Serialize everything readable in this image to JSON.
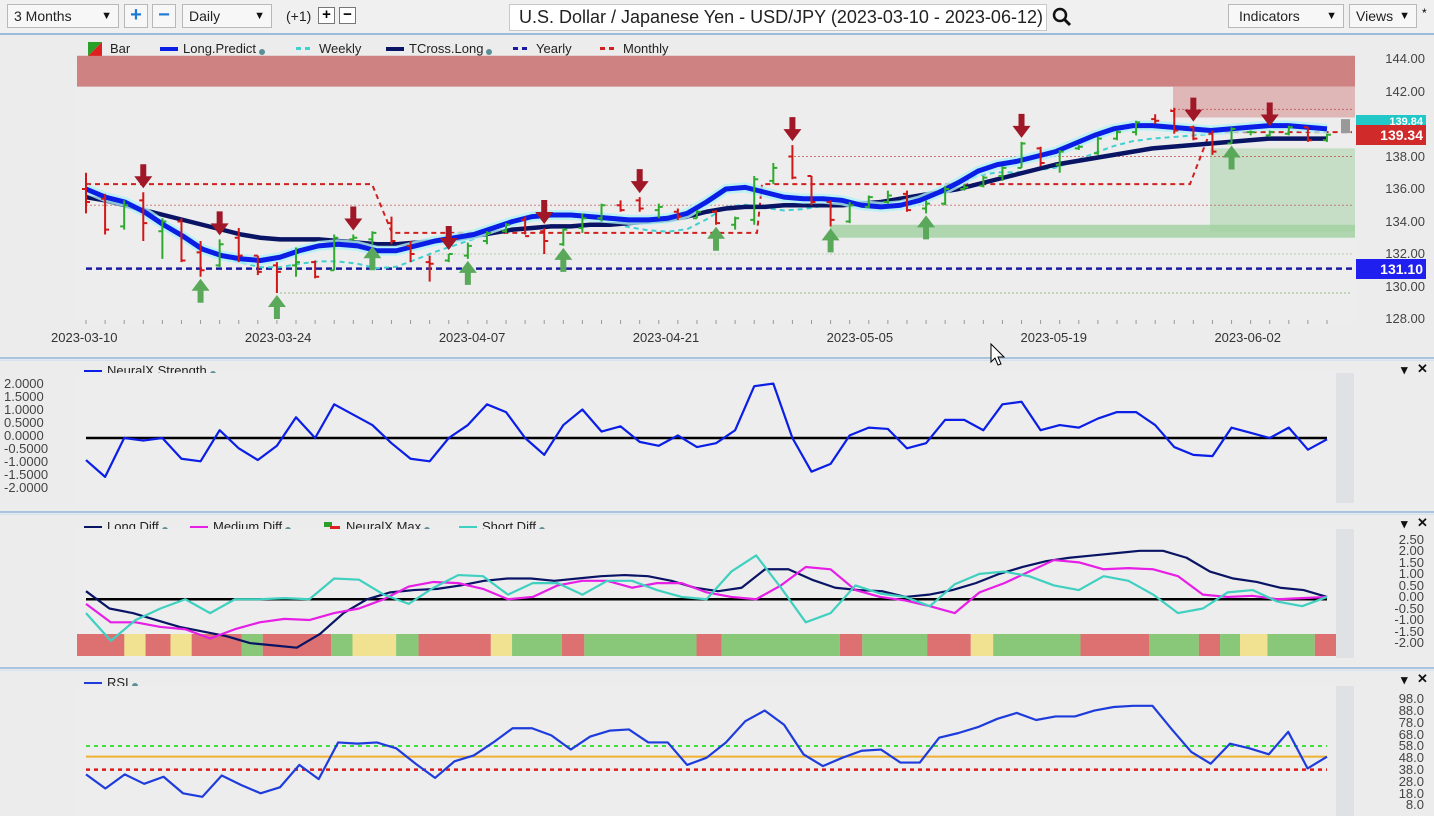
{
  "toolbar": {
    "range_select": "3 Months",
    "zoom_in": "+",
    "zoom_out": "−",
    "interval_select": "Daily",
    "offset_label": "(+1)",
    "offset_plus": "+",
    "offset_minus": "−",
    "title": "U.S. Dollar / Japanese Yen - USD/JPY (2023-03-10 - 2023-06-12)",
    "indicators_select": "Indicators",
    "views_select": "Views",
    "views_marker": "*"
  },
  "price_panel": {
    "legend": [
      {
        "label": "Bar",
        "color": "#2aa02a",
        "style": "bar"
      },
      {
        "label": "Long.Predict",
        "color": "#0a1ee6",
        "style": "solid",
        "dot": true
      },
      {
        "label": "Weekly",
        "color": "#3fd0d0",
        "style": "dash"
      },
      {
        "label": "TCross.Long",
        "color": "#0a1464",
        "style": "solid",
        "dot": true
      },
      {
        "label": "Yearly",
        "color": "#1a1aa0",
        "style": "dash"
      },
      {
        "label": "Monthly",
        "color": "#d02020",
        "style": "dash"
      }
    ],
    "current_price": "139.34",
    "predict_price": "139.84",
    "yearly_level": "131.10",
    "colors": {
      "bull": "#2faa2f",
      "bear": "#d01818",
      "arrow_down": "#a01828",
      "arrow_up": "#5aa85a",
      "resistance_zone": "#c8706e",
      "support_zone": "#9fcf9f",
      "tag_current": "#d02a2a",
      "tag_yearly": "#1f1ff0",
      "tag_predict": "#22c8c8"
    }
  },
  "neural_panel": {
    "legend": [
      {
        "label": "NeuralX.Strength",
        "color": "#0a1ee6",
        "dot": true
      }
    ]
  },
  "diff_panel": {
    "legend": [
      {
        "label": "Long.Diff",
        "color": "#0a1464",
        "dot": true
      },
      {
        "label": "Medium.Diff",
        "color": "#e61ee6",
        "dot": true
      },
      {
        "label": "NeuralX.Max",
        "color": "#d02020",
        "dot": true
      },
      {
        "label": "Short.Diff",
        "color": "#3fd0c0",
        "dot": true
      }
    ]
  },
  "rsi_panel": {
    "legend": [
      {
        "label": "RSI",
        "color": "#1e3cdc",
        "dot": true
      }
    ]
  },
  "panel_controls": {
    "menu": "▾",
    "close": "✕"
  },
  "chart_data": [
    {
      "type": "ohlc",
      "title": "U.S. Dollar / Japanese Yen - USD/JPY (2023-03-10 - 2023-06-12)",
      "ylim": [
        127.5,
        144.5
      ],
      "yticks": [
        "144.00",
        "142.00",
        "140.00",
        "138.00",
        "136.00",
        "134.00",
        "132.00",
        "130.00",
        "128.00"
      ],
      "xticks": [
        "2023-03-10",
        "2023-03-24",
        "2023-04-07",
        "2023-04-21",
        "2023-05-05",
        "2023-05-19",
        "2023-06-02"
      ],
      "bars": [
        {
          "o": 136.0,
          "h": 137.0,
          "l": 134.5,
          "c": 135.2
        },
        {
          "o": 135.4,
          "h": 135.7,
          "l": 133.2,
          "c": 133.5
        },
        {
          "o": 133.7,
          "h": 135.3,
          "l": 133.5,
          "c": 135.0
        },
        {
          "o": 135.3,
          "h": 135.8,
          "l": 132.8,
          "c": 133.9
        },
        {
          "o": 133.4,
          "h": 134.2,
          "l": 131.7,
          "c": 134.0
        },
        {
          "o": 134.0,
          "h": 134.2,
          "l": 131.5,
          "c": 131.6
        },
        {
          "o": 132.1,
          "h": 132.8,
          "l": 130.6,
          "c": 131.0
        },
        {
          "o": 131.3,
          "h": 132.9,
          "l": 131.2,
          "c": 132.6
        },
        {
          "o": 133.0,
          "h": 133.6,
          "l": 131.5,
          "c": 131.9
        },
        {
          "o": 131.9,
          "h": 131.9,
          "l": 130.7,
          "c": 130.9
        },
        {
          "o": 131.3,
          "h": 131.5,
          "l": 129.6,
          "c": 130.9
        },
        {
          "o": 131.3,
          "h": 132.4,
          "l": 130.6,
          "c": 131.5
        },
        {
          "o": 131.5,
          "h": 131.6,
          "l": 130.5,
          "c": 130.6
        },
        {
          "o": 131.0,
          "h": 133.2,
          "l": 131.0,
          "c": 133.0
        },
        {
          "o": 132.9,
          "h": 133.2,
          "l": 132.8,
          "c": 133.0
        },
        {
          "o": 132.9,
          "h": 133.4,
          "l": 132.6,
          "c": 133.3
        },
        {
          "o": 133.9,
          "h": 134.3,
          "l": 132.6,
          "c": 132.8
        },
        {
          "o": 132.5,
          "h": 132.8,
          "l": 131.5,
          "c": 132.0
        },
        {
          "o": 131.5,
          "h": 131.9,
          "l": 130.3,
          "c": 131.4
        },
        {
          "o": 131.6,
          "h": 132.0,
          "l": 131.5,
          "c": 132.0
        },
        {
          "o": 131.9,
          "h": 132.7,
          "l": 131.7,
          "c": 132.5
        },
        {
          "o": 132.8,
          "h": 133.4,
          "l": 132.6,
          "c": 133.3
        },
        {
          "o": 133.4,
          "h": 133.9,
          "l": 133.3,
          "c": 133.8
        },
        {
          "o": 134.1,
          "h": 134.3,
          "l": 133.2,
          "c": 133.1
        },
        {
          "o": 133.4,
          "h": 133.6,
          "l": 132.0,
          "c": 132.8
        },
        {
          "o": 132.6,
          "h": 133.6,
          "l": 132.5,
          "c": 133.5
        },
        {
          "o": 133.6,
          "h": 134.5,
          "l": 133.3,
          "c": 134.2
        },
        {
          "o": 134.2,
          "h": 135.1,
          "l": 134.0,
          "c": 135.0
        },
        {
          "o": 135.0,
          "h": 135.3,
          "l": 134.6,
          "c": 134.7
        },
        {
          "o": 135.3,
          "h": 135.5,
          "l": 134.6,
          "c": 134.8
        },
        {
          "o": 134.7,
          "h": 135.1,
          "l": 134.2,
          "c": 134.9
        },
        {
          "o": 134.6,
          "h": 134.8,
          "l": 134.1,
          "c": 134.3
        },
        {
          "o": 134.2,
          "h": 134.7,
          "l": 134.2,
          "c": 134.6
        },
        {
          "o": 134.6,
          "h": 134.7,
          "l": 133.8,
          "c": 133.9
        },
        {
          "o": 133.8,
          "h": 134.3,
          "l": 133.5,
          "c": 134.2
        },
        {
          "o": 134.1,
          "h": 136.8,
          "l": 133.8,
          "c": 136.6
        },
        {
          "o": 136.5,
          "h": 137.6,
          "l": 136.3,
          "c": 137.3
        },
        {
          "o": 138.0,
          "h": 138.7,
          "l": 136.6,
          "c": 136.7
        },
        {
          "o": 136.8,
          "h": 136.8,
          "l": 135.0,
          "c": 135.2
        },
        {
          "o": 135.2,
          "h": 135.3,
          "l": 133.7,
          "c": 134.1
        },
        {
          "o": 134.0,
          "h": 135.2,
          "l": 133.9,
          "c": 135.0
        },
        {
          "o": 134.9,
          "h": 135.6,
          "l": 134.8,
          "c": 135.5
        },
        {
          "o": 135.2,
          "h": 135.9,
          "l": 135.1,
          "c": 135.6
        },
        {
          "o": 135.7,
          "h": 135.9,
          "l": 134.6,
          "c": 134.7
        },
        {
          "o": 134.8,
          "h": 135.3,
          "l": 134.5,
          "c": 135.1
        },
        {
          "o": 135.1,
          "h": 136.2,
          "l": 135.0,
          "c": 136.0
        },
        {
          "o": 136.0,
          "h": 136.3,
          "l": 135.9,
          "c": 136.1
        },
        {
          "o": 136.2,
          "h": 136.8,
          "l": 136.1,
          "c": 136.7
        },
        {
          "o": 136.8,
          "h": 137.4,
          "l": 136.5,
          "c": 137.3
        },
        {
          "o": 137.3,
          "h": 138.9,
          "l": 137.3,
          "c": 138.8
        },
        {
          "o": 138.5,
          "h": 138.6,
          "l": 137.4,
          "c": 137.6
        },
        {
          "o": 137.5,
          "h": 138.4,
          "l": 137.0,
          "c": 138.3
        },
        {
          "o": 138.5,
          "h": 138.7,
          "l": 138.4,
          "c": 138.6
        },
        {
          "o": 138.2,
          "h": 139.2,
          "l": 138.1,
          "c": 139.1
        },
        {
          "o": 139.1,
          "h": 139.6,
          "l": 139.0,
          "c": 139.5
        },
        {
          "o": 139.5,
          "h": 140.2,
          "l": 139.3,
          "c": 140.1
        },
        {
          "o": 140.3,
          "h": 140.6,
          "l": 140.0,
          "c": 140.2
        },
        {
          "o": 140.8,
          "h": 141.0,
          "l": 139.4,
          "c": 139.6
        },
        {
          "o": 139.8,
          "h": 139.9,
          "l": 139.0,
          "c": 139.1
        },
        {
          "o": 139.4,
          "h": 139.6,
          "l": 138.1,
          "c": 138.3
        },
        {
          "o": 138.8,
          "h": 139.8,
          "l": 138.8,
          "c": 139.7
        },
        {
          "o": 139.5,
          "h": 139.6,
          "l": 139.3,
          "c": 139.5
        },
        {
          "o": 139.3,
          "h": 139.6,
          "l": 139.2,
          "c": 139.5
        },
        {
          "o": 139.4,
          "h": 139.9,
          "l": 139.3,
          "c": 139.8
        },
        {
          "o": 139.8,
          "h": 139.8,
          "l": 138.9,
          "c": 139.0
        },
        {
          "o": 139.0,
          "h": 139.4,
          "l": 138.9,
          "c": 139.34
        }
      ],
      "long_predict": [
        136.0,
        135.5,
        135.2,
        134.6,
        133.8,
        133.1,
        132.3,
        131.9,
        131.7,
        131.6,
        131.8,
        132.2,
        132.5,
        132.6,
        132.5,
        132.2,
        132.2,
        132.5,
        132.8,
        133.0,
        133.2,
        133.6,
        134.0,
        134.3,
        134.4,
        134.4,
        134.3,
        134.2,
        134.1,
        134.1,
        134.2,
        134.5,
        135.2,
        136.0,
        136.1,
        135.8,
        135.5,
        135.4,
        135.4,
        135.3,
        135.0,
        134.9,
        135.0,
        135.3,
        135.8,
        136.4,
        137.1,
        137.5,
        137.7,
        138.0,
        138.3,
        138.8,
        139.3,
        139.7,
        139.9,
        139.9,
        139.8,
        139.7,
        139.6,
        139.7,
        139.8,
        139.9,
        139.9,
        139.8,
        139.7
      ],
      "tcross_long": [
        135.5,
        135.3,
        135.0,
        134.7,
        134.4,
        134.1,
        133.8,
        133.5,
        133.2,
        133.0,
        132.9,
        132.9,
        132.9,
        132.8,
        132.7,
        132.6,
        132.6,
        132.7,
        132.8,
        132.9,
        133.1,
        133.3,
        133.5,
        133.6,
        133.7,
        133.7,
        133.8,
        133.8,
        133.9,
        134.0,
        134.1,
        134.3,
        134.6,
        134.8,
        134.9,
        134.9,
        135.0,
        135.0,
        135.0,
        135.0,
        135.1,
        135.2,
        135.4,
        135.6,
        135.8,
        136.0,
        136.3,
        136.6,
        136.9,
        137.2,
        137.5,
        137.7,
        137.9,
        138.1,
        138.3,
        138.5,
        138.6,
        138.7,
        138.8,
        138.9,
        139.0,
        139.1,
        139.1,
        139.1,
        139.1
      ],
      "levels": {
        "yearly": 131.1,
        "resistance_zone": [
          142.3,
          144.2
        ],
        "support_zone_top": 133.3
      },
      "signals_down": [
        3,
        7,
        14,
        19,
        24,
        29,
        37,
        49,
        58,
        62
      ],
      "signals_up": [
        6,
        10,
        15,
        20,
        25,
        33,
        39,
        44,
        60
      ]
    },
    {
      "type": "line",
      "title": "NeuralX.Strength",
      "ylim": [
        -2.2,
        2.2
      ],
      "yticks": [
        "2.0000",
        "1.5000",
        "1.0000",
        "0.5000",
        "0.0000",
        "-0.5000",
        "-1.0000",
        "-1.5000",
        "-2.0000"
      ],
      "series": [
        {
          "name": "NeuralX.Strength",
          "values": [
            -0.85,
            -1.5,
            0.0,
            -0.1,
            0.0,
            -0.8,
            -0.9,
            0.3,
            -0.4,
            -0.85,
            -0.3,
            0.8,
            0.0,
            1.3,
            0.9,
            0.5,
            -0.2,
            -0.8,
            -0.9,
            0.0,
            0.5,
            1.3,
            1.0,
            0.0,
            -0.65,
            0.5,
            1.1,
            0.25,
            0.45,
            -0.15,
            -0.3,
            0.1,
            -0.35,
            -0.2,
            0.3,
            2.0,
            2.1,
            0.0,
            -1.3,
            -1.0,
            0.1,
            0.4,
            0.35,
            -0.4,
            -0.2,
            0.7,
            0.7,
            0.3,
            1.3,
            1.4,
            0.3,
            0.5,
            0.4,
            0.75,
            1.0,
            1.0,
            0.5,
            -0.35,
            -0.65,
            -0.7,
            0.4,
            0.2,
            0.0,
            0.4,
            -0.45,
            -0.05
          ]
        }
      ]
    },
    {
      "type": "line",
      "title": "Long.Diff / Medium.Diff / NeuralX.Max / Short.Diff",
      "ylim": [
        -2.2,
        2.7
      ],
      "yticks": [
        "2.50",
        "2.00",
        "1.50",
        "1.00",
        "0.50",
        "0.00",
        "-0.50",
        "-1.00",
        "-1.50",
        "-2.00"
      ],
      "series": [
        {
          "name": "Long.Diff",
          "values": [
            0.35,
            -0.4,
            -0.6,
            -0.9,
            -1.2,
            -1.4,
            -1.6,
            -1.9,
            -2.0,
            -2.1,
            -1.5,
            -0.6,
            0.0,
            0.3,
            0.4,
            0.45,
            0.6,
            0.8,
            0.9,
            0.9,
            0.8,
            0.9,
            1.0,
            1.05,
            1.0,
            0.8,
            0.5,
            0.35,
            0.5,
            1.3,
            1.3,
            0.85,
            0.5,
            0.4,
            0.35,
            0.1,
            0.2,
            0.4,
            0.7,
            1.1,
            1.4,
            1.65,
            1.8,
            1.9,
            2.0,
            2.1,
            2.1,
            1.8,
            1.2,
            0.9,
            0.75,
            0.5,
            0.4,
            0.1
          ]
        },
        {
          "name": "Medium.Diff",
          "values": [
            -0.2,
            -1.0,
            -1.0,
            -1.2,
            -1.3,
            -1.7,
            -1.3,
            -1.0,
            -0.85,
            -0.9,
            -0.6,
            -0.4,
            0.0,
            0.55,
            0.75,
            0.7,
            0.45,
            0.0,
            0.1,
            0.6,
            0.8,
            0.8,
            0.5,
            0.7,
            0.7,
            0.3,
            0.1,
            0.0,
            0.6,
            1.4,
            1.3,
            0.4,
            0.1,
            -0.05,
            -0.3,
            -0.6,
            0.3,
            0.7,
            1.2,
            1.7,
            1.6,
            1.3,
            1.35,
            1.3,
            1.0,
            0.2,
            0.1,
            0.15,
            0.0,
            0.05,
            0.1
          ]
        },
        {
          "name": "Short.Diff",
          "values": [
            -0.6,
            -1.8,
            -0.9,
            -0.4,
            0.0,
            -0.6,
            0.0,
            0.0,
            0.05,
            0.0,
            0.9,
            0.85,
            0.2,
            -0.2,
            0.5,
            1.05,
            1.0,
            0.2,
            0.7,
            0.7,
            0.2,
            0.8,
            0.8,
            0.4,
            0.1,
            0.0,
            1.2,
            1.9,
            0.5,
            -1.0,
            -0.6,
            0.6,
            0.25,
            0.1,
            -0.3,
            0.65,
            1.1,
            1.2,
            1.0,
            0.6,
            0.4,
            1.0,
            0.8,
            0.2,
            -0.6,
            -0.4,
            0.3,
            0.4,
            -0.1,
            -0.3,
            0.1
          ]
        }
      ],
      "neuralx_max_blocks": [
        "red",
        "yellow",
        "red",
        "yellow",
        "red",
        "green",
        "red",
        "green",
        "yellow",
        "green",
        "red",
        "yellow",
        "green",
        "red",
        "green",
        "red",
        "green",
        "red",
        "green",
        "red",
        "yellow",
        "green",
        "red",
        "green",
        "red",
        "green",
        "yellow",
        "green",
        "red"
      ]
    },
    {
      "type": "line",
      "title": "RSI",
      "ylim": [
        5,
        104
      ],
      "yticks": [
        "98.0",
        "88.0",
        "78.0",
        "68.0",
        "58.0",
        "48.0",
        "38.0",
        "28.0",
        "18.0",
        "8.0"
      ],
      "levels": {
        "upper": 60,
        "middle": 51,
        "lower": 40
      },
      "series": [
        {
          "name": "RSI",
          "values": [
            36,
            24,
            36,
            28,
            34,
            20,
            17,
            35,
            27,
            20,
            25,
            44,
            32,
            63,
            62,
            63,
            58,
            45,
            33,
            47,
            52,
            63,
            75,
            75,
            69,
            57,
            68,
            73,
            74,
            63,
            63,
            44,
            50,
            63,
            81,
            90,
            78,
            53,
            43,
            50,
            56,
            57,
            46,
            46,
            67,
            71,
            76,
            83,
            88,
            82,
            85,
            85,
            90,
            93,
            94,
            94,
            74,
            55,
            45,
            62,
            58,
            53,
            72,
            41,
            51
          ]
        }
      ]
    }
  ]
}
